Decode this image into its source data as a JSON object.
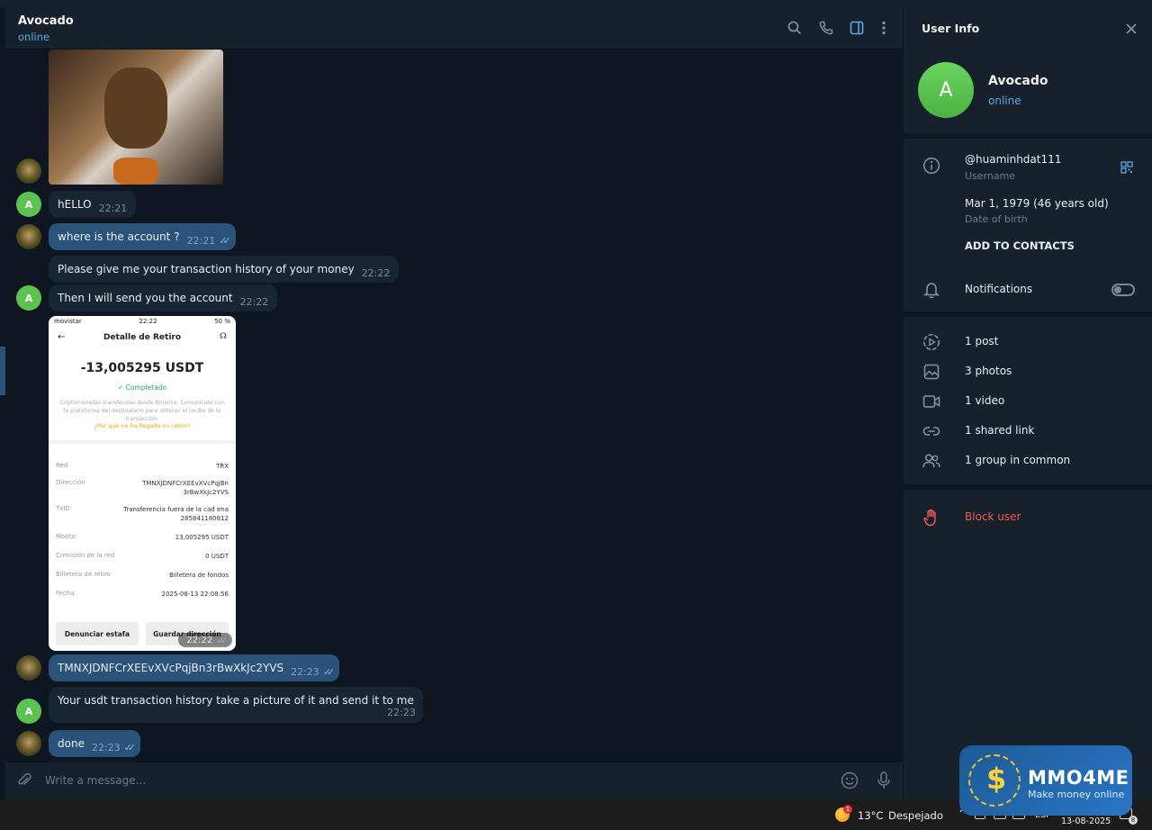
{
  "header": {
    "title": "Avocado",
    "status": "online"
  },
  "messages": {
    "m1": {
      "text": "hELLO",
      "time": "22:21"
    },
    "m2": {
      "text": "where is the account ?",
      "time": "22:21"
    },
    "m3": {
      "text": "Please give me your transaction history of your money",
      "time": "22:22"
    },
    "m4": {
      "text": "Then I will send you the account",
      "time": "22:22"
    },
    "m5": {
      "text": "TMNXJDNFCrXEEvXVcPqjBn3rBwXkJc2YVS",
      "time": "22:23"
    },
    "m6": {
      "text": "Your usdt transaction history take a picture of it and send it to me",
      "time": "22:23"
    },
    "m7": {
      "text": "done",
      "time": "22:23"
    },
    "photo_time": "22:22",
    "avatar_letter": "A"
  },
  "receipt": {
    "carrier": "movistar",
    "clock": "22:22",
    "battery": "50 %",
    "title": "Detalle de Retiro",
    "amount": "-13,005295 USDT",
    "status": "Completado",
    "description": "Criptomonedas transferidas desde Binance. Comunícate con la plataforma del destinatario para obtener el recibo de la transacción.",
    "question": "¿Por qué no ha llegado mi retiro?",
    "rows": [
      {
        "k": "Red",
        "v": "TRX"
      },
      {
        "k": "Dirección",
        "v": "TMNXJDNFCrXEEvXVcPqjBn 3rBwXkJc2YVS"
      },
      {
        "k": "TxID",
        "v": "Transferencia fuera de la cad ena 285841180812"
      },
      {
        "k": "Monto",
        "v": "13,005295 USDT"
      },
      {
        "k": "Comisión de la red",
        "v": "0 USDT"
      },
      {
        "k": "Billetera de retiro",
        "v": "Billetera de fondos"
      },
      {
        "k": "Fecha",
        "v": "2025-08-13 22:08:56"
      }
    ],
    "btn_report": "Denunciar estafa",
    "btn_save": "Guardar dirección"
  },
  "compose": {
    "placeholder": "Write a message..."
  },
  "info": {
    "title": "User Info",
    "name": "Avocado",
    "status": "online",
    "avatar_letter": "A",
    "username": "@huaminhdat111",
    "username_label": "Username",
    "dob": "Mar 1, 1979 (46 years old)",
    "dob_label": "Date of birth",
    "add_contacts": "ADD TO CONTACTS",
    "notifications": "Notifications",
    "notifications_on": false,
    "media": {
      "posts": "1 post",
      "photos": "3 photos",
      "videos": "1 video",
      "links": "1 shared link",
      "groups": "1 group in common"
    },
    "block": "Block user"
  },
  "taskbar": {
    "weather": "13°C",
    "condition": "Despejado",
    "lang": "ESP",
    "date": "13-08-2025",
    "notif_count": "8",
    "weather_badge": "1"
  },
  "watermark": {
    "brand": "MMO4ME",
    "tagline": "Make money online"
  },
  "colors": {
    "accent": "#5aa9e6",
    "out_bubble": "#2b5278",
    "in_bubble": "#182533",
    "danger": "#ec5a5a",
    "avatar_green": "#5cc350"
  }
}
